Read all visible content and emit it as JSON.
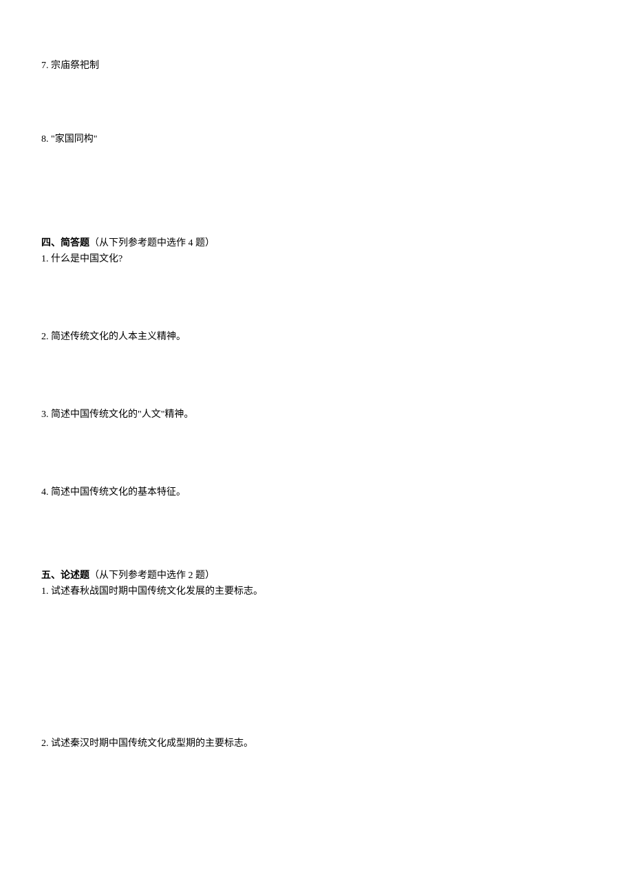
{
  "terms": {
    "item7": "7. 宗庙祭祀制",
    "item8": "8. \"家国同构\""
  },
  "section4": {
    "title": "四、简答题",
    "note": "（从下列参考题中选作 4 题）",
    "q1": "1. 什么是中国文化?",
    "q2": "2. 简述传统文化的人本主义精神。",
    "q3": "3. 简述中国传统文化的\"人文\"精神。",
    "q4": "4. 简述中国传统文化的基本特征。"
  },
  "section5": {
    "title": "五、论述题",
    "note": "（从下列参考题中选作 2 题）",
    "q1": "1. 试述春秋战国时期中国传统文化发展的主要标志。",
    "q2": "2. 试述秦汉时期中国传统文化成型期的主要标志。"
  }
}
